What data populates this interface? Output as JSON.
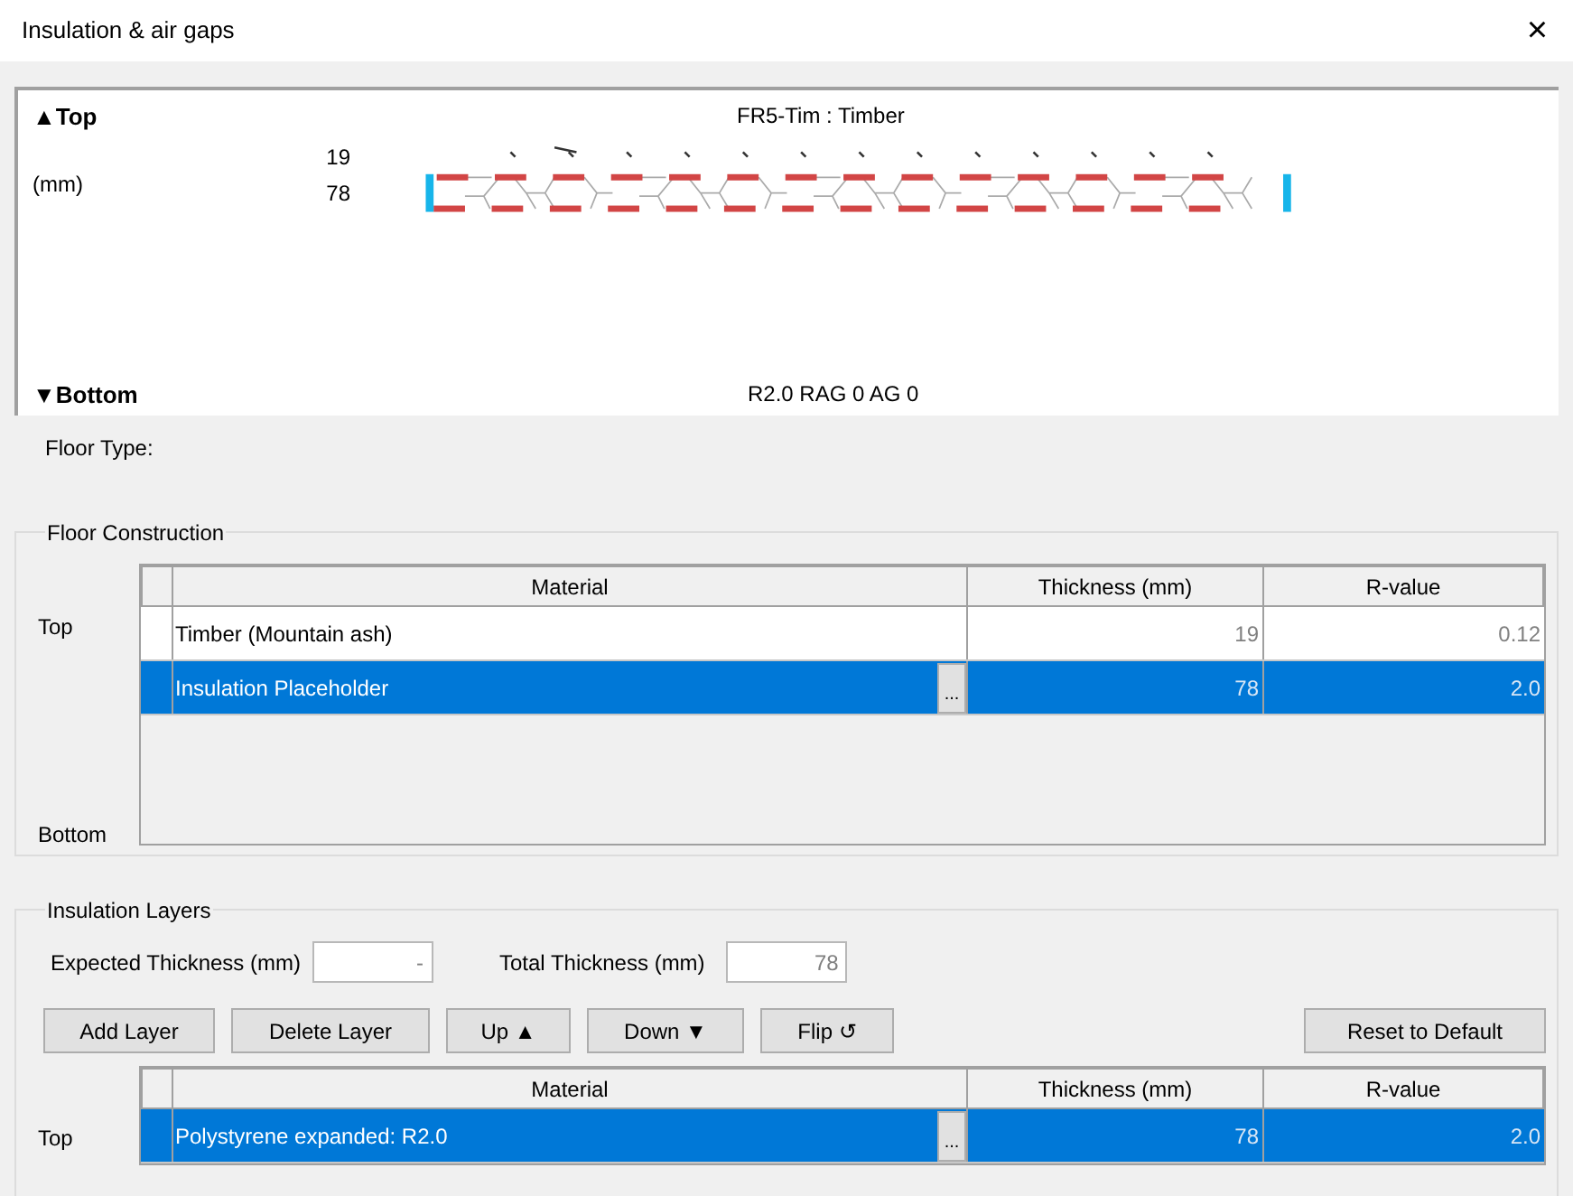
{
  "window": {
    "title": "Insulation & air gaps",
    "close": "×"
  },
  "preview": {
    "top_label": "▲Top",
    "bottom_label": "▼Bottom",
    "unit": "(mm)",
    "name": "FR5-Tim : Timber",
    "ticks": [
      "19",
      "78"
    ],
    "summary": "R2.0 RAG 0 AG 0"
  },
  "floor_type": {
    "label": "Floor Type:"
  },
  "floor_construction": {
    "title": "Floor Construction",
    "top_label": "Top",
    "bottom_label": "Bottom",
    "columns": [
      "Material",
      "Thickness (mm)",
      "R-value"
    ],
    "rows": [
      {
        "material": "Timber (Mountain ash)",
        "thickness": "19",
        "r_value": "0.12",
        "selected": false
      },
      {
        "material": "Insulation Placeholder",
        "thickness": "78",
        "r_value": "2.0",
        "selected": true,
        "browse": "..."
      }
    ]
  },
  "insulation_layers": {
    "title": "Insulation Layers",
    "expected_label": "Expected Thickness (mm)",
    "expected_value": "-",
    "total_label": "Total Thickness (mm)",
    "total_value": "78",
    "buttons": [
      "Add Layer",
      "Delete Layer",
      "Up ▲",
      "Down ▼",
      "Flip ↺"
    ],
    "reset": "Reset to Default",
    "top_label": "Top",
    "columns": [
      "Material",
      "Thickness (mm)",
      "R-value"
    ],
    "rows": [
      {
        "material": "Polystyrene expanded: R2.0",
        "thickness": "78",
        "r_value": "2.0",
        "selected": true,
        "browse": "..."
      }
    ]
  }
}
